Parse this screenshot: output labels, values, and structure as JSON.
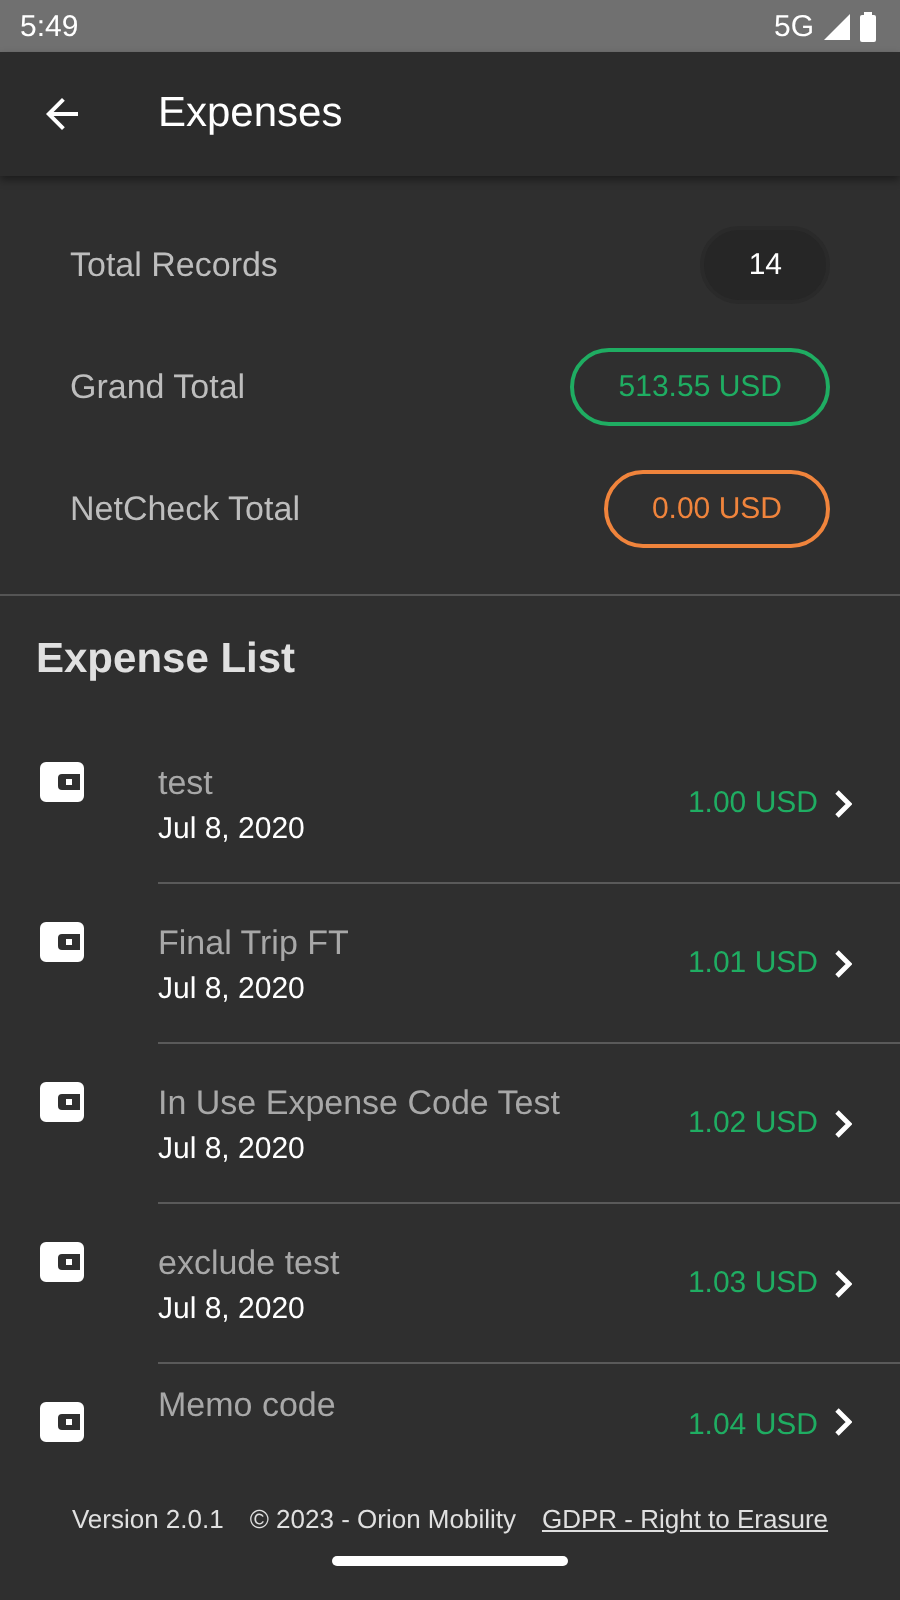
{
  "status_bar": {
    "time": "5:49",
    "network": "5G"
  },
  "app_bar": {
    "title": "Expenses"
  },
  "summary": [
    {
      "label": "Total Records",
      "value": "14",
      "kind": "plain"
    },
    {
      "label": "Grand Total",
      "value": "513.55 USD",
      "kind": "green"
    },
    {
      "label": "NetCheck Total",
      "value": "0.00 USD",
      "kind": "orange"
    }
  ],
  "list_title": "Expense List",
  "expenses": [
    {
      "name": "test",
      "date": "Jul 8, 2020",
      "amount": "1.00 USD"
    },
    {
      "name": "Final Trip FT",
      "date": "Jul 8, 2020",
      "amount": "1.01 USD"
    },
    {
      "name": "In Use Expense Code Test",
      "date": "Jul 8, 2020",
      "amount": "1.02 USD"
    },
    {
      "name": "exclude test",
      "date": "Jul 8, 2020",
      "amount": "1.03 USD"
    },
    {
      "name": "Memo code",
      "amount": "1.04 USD"
    }
  ],
  "footer": {
    "version": "Version 2.0.1",
    "copyright": "© 2023 - Orion Mobility",
    "link": "GDPR - Right to Erasure"
  }
}
